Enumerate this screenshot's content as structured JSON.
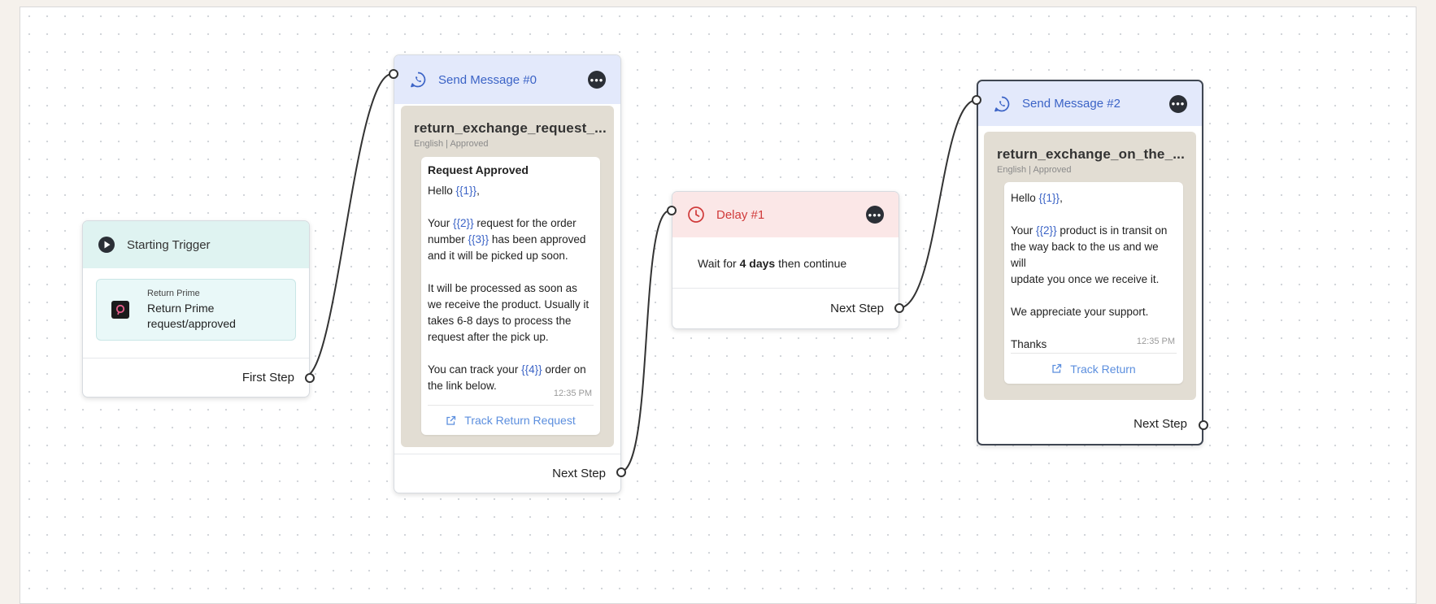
{
  "trigger": {
    "title": "Starting Trigger",
    "app_small": "Return Prime",
    "app_event_line1": "Return Prime",
    "app_event_line2": "request/approved",
    "footer": "First Step"
  },
  "message0": {
    "title": "Send Message #0",
    "template_name": "return_exchange_request_...",
    "template_meta": "English | Approved",
    "heading": "Request Approved",
    "hello": "Hello ",
    "v1": "{{1}}",
    "comma": ",",
    "p1a": "Your ",
    "v2": "{{2}}",
    "p1b": " request for the order",
    "p1c": "number ",
    "v3": "{{3}}",
    "p1d": " has been approved",
    "p1e": "and it will be picked up soon.",
    "p2a": "It will be processed as soon as",
    "p2b": "we receive the product. Usually it",
    "p2c": "takes 6-8 days to process the",
    "p2d": "request after the pick up.",
    "p3a": "You can track your ",
    "v4": "{{4}}",
    "p3b": " order on",
    "p3c": "the link below.",
    "time": "12:35 PM",
    "button": "Track Return Request",
    "footer": "Next Step"
  },
  "delay": {
    "title": "Delay #1",
    "text_pre": "Wait for ",
    "text_bold": "4 days",
    "text_post": " then continue",
    "footer": "Next Step"
  },
  "message2": {
    "title": "Send Message #2",
    "template_name": "return_exchange_on_the_...",
    "template_meta": "English | Approved",
    "hello": "Hello ",
    "v1": "{{1}}",
    "comma": ",",
    "p1a": "Your ",
    "v2": "{{2}}",
    "p1b": " product is in transit on",
    "p1c": "the way back to the us and we will",
    "p1d": "update you once we receive it.",
    "p2": "We appreciate your support.",
    "p3": "Thanks",
    "time": "12:35 PM",
    "button": "Track Return",
    "footer": "Next Step"
  },
  "colors": {
    "accent_blue": "#3b63c6",
    "delay_red": "#d03a3a",
    "trigger_teal": "#dff3f1",
    "link_blue": "#5b8ede"
  },
  "icons": [
    "play-icon",
    "whatsapp-icon",
    "clock-icon",
    "more-icon",
    "external-link-icon"
  ]
}
